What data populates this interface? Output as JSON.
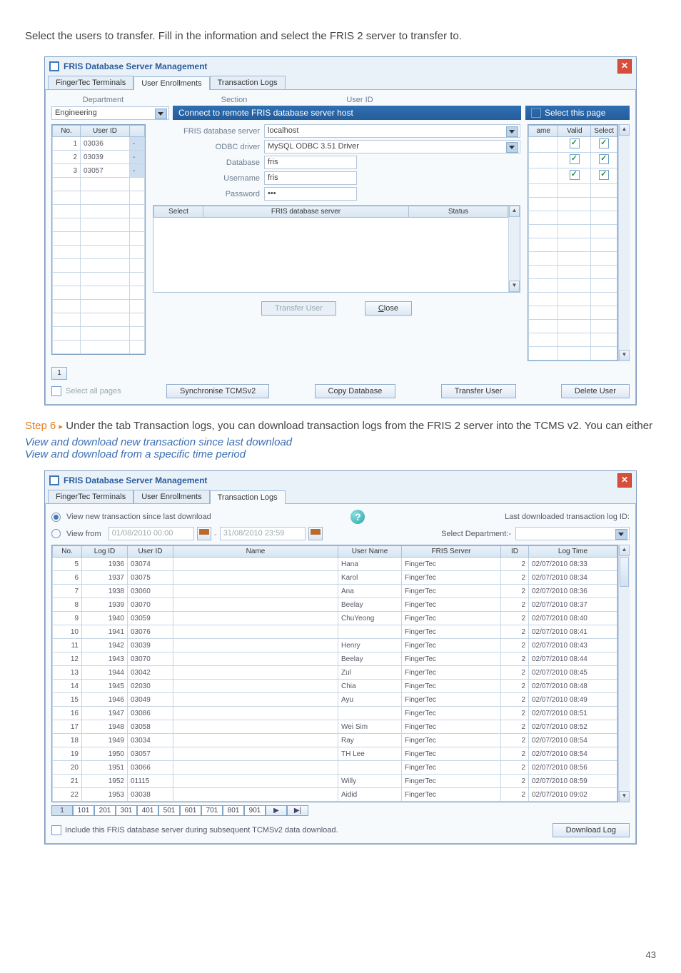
{
  "intro": "Select the users to transfer. Fill in the information and select the FRIS 2 server to transfer to.",
  "step6_prefix": "Step 6",
  "step6_arrow": "▸",
  "step6_body": "Under the tab Transaction logs, you can download transaction logs from the FRIS 2 server into the TCMS v2. You can either",
  "step6_italic1": "View and download new transaction since last download",
  "step6_italic2": "View and download from a specific time period",
  "page_number": "43",
  "win1": {
    "title": "FRIS Database Server Management",
    "tabs": [
      "FingerTec Terminals",
      "User Enrollments",
      "Transaction Logs"
    ],
    "active_tab": 1,
    "label_department": "Department",
    "label_section": "Section",
    "label_userid_top": "User ID",
    "department_value": "Engineering",
    "header_connect": "Connect to remote FRIS database server host",
    "select_this_page": "Select this page",
    "left_headers": [
      "No.",
      "User ID"
    ],
    "left_rows": [
      {
        "no": "1",
        "uid": "03036"
      },
      {
        "no": "2",
        "uid": "03039"
      },
      {
        "no": "3",
        "uid": "03057"
      }
    ],
    "form": {
      "lbl_server": "FRIS database server",
      "val_server": "localhost",
      "lbl_odbc": "ODBC driver",
      "val_odbc": "MySQL ODBC 3.51 Driver",
      "lbl_db": "Database",
      "val_db": "fris",
      "lbl_user": "Username",
      "val_user": "fris",
      "lbl_pass": "Password",
      "val_pass": "•••"
    },
    "inner_headers": [
      "Select",
      "FRIS database server",
      "Status"
    ],
    "btn_transfer_user": "Transfer User",
    "btn_close": "Close",
    "right_headers": [
      "ame",
      "Valid",
      "Select"
    ],
    "cb_select_all": "Select all pages",
    "btn_sync": "Synchronise TCMSv2",
    "btn_copy": "Copy Database",
    "btn_transfer_user2": "Transfer User",
    "btn_delete_user": "Delete User",
    "page_box": "1"
  },
  "win2": {
    "title": "FRIS Database Server Management",
    "tabs": [
      "FingerTec Terminals",
      "User Enrollments",
      "Transaction Logs"
    ],
    "active_tab": 2,
    "opt_new": "View new transaction since last download",
    "opt_from": "View from",
    "date_from": "01/08/2010 00:00",
    "date_to": "31/08/2010 23:59",
    "label_last": "Last downloaded transaction log ID:",
    "label_select_dept": "Select Department:-",
    "headers": [
      "No.",
      "Log ID",
      "User ID",
      "Name",
      "User Name",
      "FRIS Server",
      "ID",
      "Log Time"
    ],
    "rows": [
      {
        "no": "5",
        "log": "1936",
        "uid": "03074",
        "name": "",
        "un": "Hana",
        "srv": "FingerTec",
        "id": "2",
        "dt": "02/07/2010 08:33"
      },
      {
        "no": "6",
        "log": "1937",
        "uid": "03075",
        "name": "",
        "un": "Karol",
        "srv": "FingerTec",
        "id": "2",
        "dt": "02/07/2010 08:34"
      },
      {
        "no": "7",
        "log": "1938",
        "uid": "03060",
        "name": "",
        "un": "Ana",
        "srv": "FingerTec",
        "id": "2",
        "dt": "02/07/2010 08:36"
      },
      {
        "no": "8",
        "log": "1939",
        "uid": "03070",
        "name": "",
        "un": "Beelay",
        "srv": "FingerTec",
        "id": "2",
        "dt": "02/07/2010 08:37"
      },
      {
        "no": "9",
        "log": "1940",
        "uid": "03059",
        "name": "",
        "un": "ChuYeong",
        "srv": "FingerTec",
        "id": "2",
        "dt": "02/07/2010 08:40"
      },
      {
        "no": "10",
        "log": "1941",
        "uid": "03076",
        "name": "",
        "un": "",
        "srv": "FingerTec",
        "id": "2",
        "dt": "02/07/2010 08:41"
      },
      {
        "no": "11",
        "log": "1942",
        "uid": "03039",
        "name": "",
        "un": "Henry",
        "srv": "FingerTec",
        "id": "2",
        "dt": "02/07/2010 08:43"
      },
      {
        "no": "12",
        "log": "1943",
        "uid": "03070",
        "name": "",
        "un": "Beelay",
        "srv": "FingerTec",
        "id": "2",
        "dt": "02/07/2010 08:44"
      },
      {
        "no": "13",
        "log": "1944",
        "uid": "03042",
        "name": "",
        "un": "Zul",
        "srv": "FingerTec",
        "id": "2",
        "dt": "02/07/2010 08:45"
      },
      {
        "no": "14",
        "log": "1945",
        "uid": "02030",
        "name": "",
        "un": "Chia",
        "srv": "FingerTec",
        "id": "2",
        "dt": "02/07/2010 08:48"
      },
      {
        "no": "15",
        "log": "1946",
        "uid": "03049",
        "name": "",
        "un": "Ayu",
        "srv": "FingerTec",
        "id": "2",
        "dt": "02/07/2010 08:49"
      },
      {
        "no": "16",
        "log": "1947",
        "uid": "03086",
        "name": "",
        "un": "",
        "srv": "FingerTec",
        "id": "2",
        "dt": "02/07/2010 08:51"
      },
      {
        "no": "17",
        "log": "1948",
        "uid": "03058",
        "name": "",
        "un": "Wei Sim",
        "srv": "FingerTec",
        "id": "2",
        "dt": "02/07/2010 08:52"
      },
      {
        "no": "18",
        "log": "1949",
        "uid": "03034",
        "name": "",
        "un": "Ray",
        "srv": "FingerTec",
        "id": "2",
        "dt": "02/07/2010 08:54"
      },
      {
        "no": "19",
        "log": "1950",
        "uid": "03057",
        "name": "",
        "un": "TH Lee",
        "srv": "FingerTec",
        "id": "2",
        "dt": "02/07/2010 08:54"
      },
      {
        "no": "20",
        "log": "1951",
        "uid": "03066",
        "name": "",
        "un": "",
        "srv": "FingerTec",
        "id": "2",
        "dt": "02/07/2010 08:56"
      },
      {
        "no": "21",
        "log": "1952",
        "uid": "01115",
        "name": "",
        "un": "Willy",
        "srv": "FingerTec",
        "id": "2",
        "dt": "02/07/2010 08:59"
      },
      {
        "no": "22",
        "log": "1953",
        "uid": "03038",
        "name": "",
        "un": "Aidid",
        "srv": "FingerTec",
        "id": "2",
        "dt": "02/07/2010 09:02"
      }
    ],
    "pager": [
      "1",
      "101",
      "201",
      "301",
      "401",
      "501",
      "601",
      "701",
      "801",
      "901",
      "▶",
      "▶|"
    ],
    "include_label": "Include this FRIS database server during subsequent TCMSv2 data download.",
    "btn_download": "Download Log"
  }
}
